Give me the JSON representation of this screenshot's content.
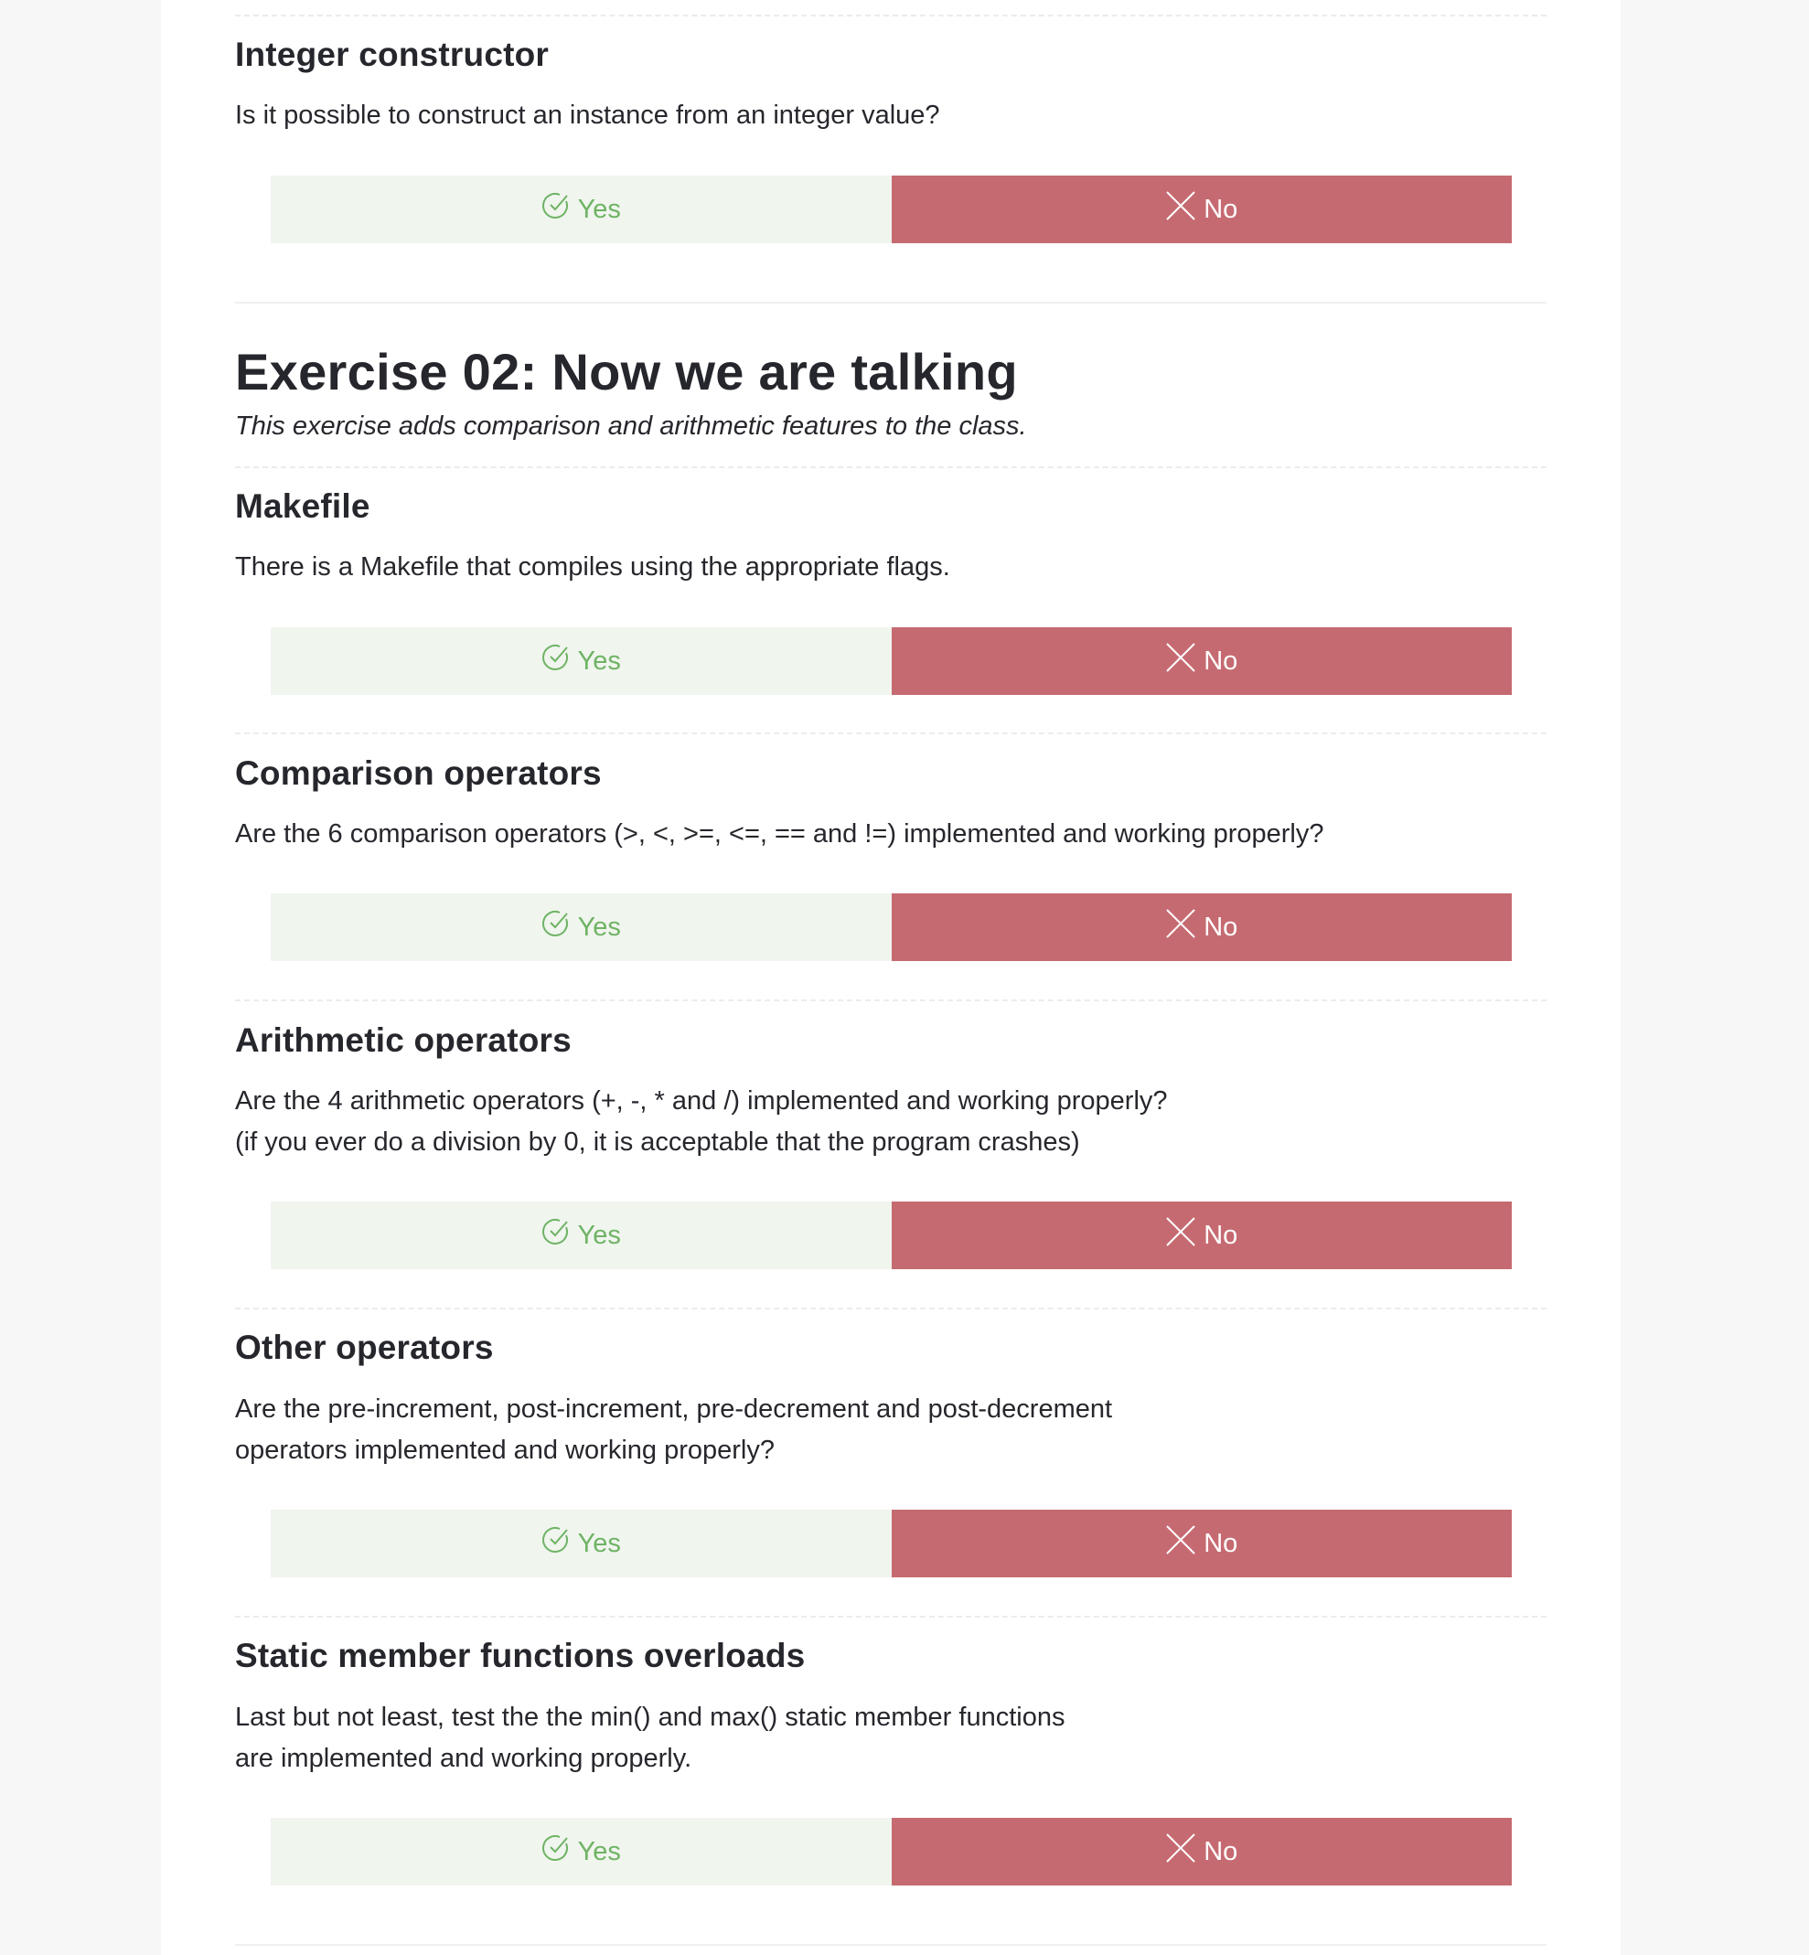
{
  "colors": {
    "yes_bg": "#f0f5ee",
    "yes_text": "#6fb365",
    "no_bg": "#c66a71",
    "no_text": "#ffffff"
  },
  "icons": {
    "yes": "check-circle-icon",
    "no": "x-icon"
  },
  "questions_top": [
    {
      "title": "Integer constructor",
      "desc": [
        "Is it possible to construct an instance from an integer value?"
      ],
      "yes_label": "Yes",
      "no_label": "No"
    }
  ],
  "exercise": {
    "title": "Exercise 02: Now we are talking",
    "subtitle": "This exercise adds comparison and arithmetic features to the class."
  },
  "questions": [
    {
      "title": "Makefile",
      "desc": [
        "There is a Makefile that compiles using the appropriate flags."
      ],
      "yes_label": "Yes",
      "no_label": "No"
    },
    {
      "title": "Comparison operators",
      "desc": [
        "Are the 6 comparison operators (>, <, >=, <=, == and !=) implemented and working properly?"
      ],
      "yes_label": "Yes",
      "no_label": "No"
    },
    {
      "title": "Arithmetic operators",
      "desc": [
        "Are the 4 arithmetic operators (+, -, * and /) implemented and working properly?",
        "(if you ever do a division by 0, it is acceptable that the program crashes)"
      ],
      "yes_label": "Yes",
      "no_label": "No"
    },
    {
      "title": "Other operators",
      "desc": [
        "Are the pre-increment, post-increment, pre-decrement and post-decrement",
        "operators implemented and working properly?"
      ],
      "yes_label": "Yes",
      "no_label": "No"
    },
    {
      "title": "Static member functions overloads",
      "desc": [
        "Last but not least, test the the min() and max() static member functions",
        "are implemented and working properly."
      ],
      "yes_label": "Yes",
      "no_label": "No"
    }
  ]
}
